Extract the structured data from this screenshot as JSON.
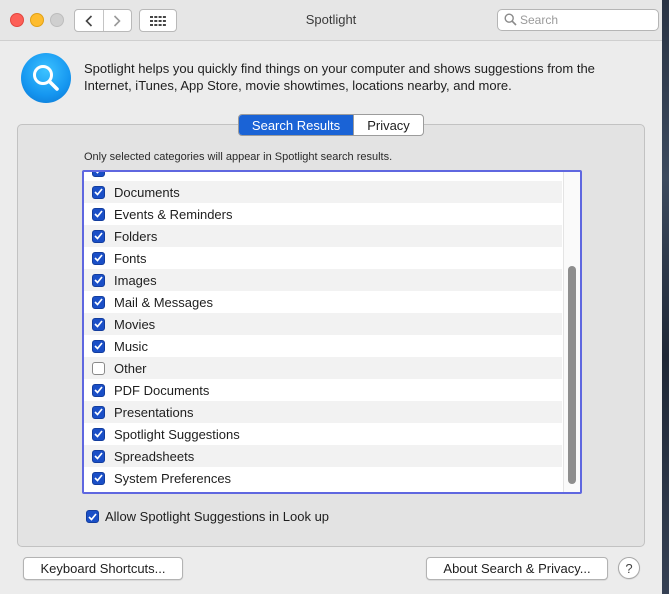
{
  "window": {
    "title": "Spotlight",
    "search_placeholder": "Search"
  },
  "intro_text": "Spotlight helps you quickly find things on your computer and shows suggestions from the Internet, iTunes, App Store, movie showtimes, locations nearby, and more.",
  "tabs": [
    {
      "label": "Search Results",
      "selected": true
    },
    {
      "label": "Privacy",
      "selected": false
    }
  ],
  "note": "Only selected categories will appear in Spotlight search results.",
  "categories": [
    {
      "label": "",
      "checked": true
    },
    {
      "label": "Documents",
      "checked": true
    },
    {
      "label": "Events & Reminders",
      "checked": true
    },
    {
      "label": "Folders",
      "checked": true
    },
    {
      "label": "Fonts",
      "checked": true
    },
    {
      "label": "Images",
      "checked": true
    },
    {
      "label": "Mail & Messages",
      "checked": true
    },
    {
      "label": "Movies",
      "checked": true
    },
    {
      "label": "Music",
      "checked": true
    },
    {
      "label": "Other",
      "checked": false
    },
    {
      "label": "PDF Documents",
      "checked": true
    },
    {
      "label": "Presentations",
      "checked": true
    },
    {
      "label": "Spotlight Suggestions",
      "checked": true
    },
    {
      "label": "Spreadsheets",
      "checked": true
    },
    {
      "label": "System Preferences",
      "checked": true
    }
  ],
  "allow_lookup": {
    "label": "Allow Spotlight Suggestions in Look up",
    "checked": true
  },
  "buttons": {
    "keyboard_shortcuts": "Keyboard Shortcuts...",
    "about": "About Search & Privacy...",
    "help": "?"
  },
  "icons": {
    "back": "chevron-left-icon",
    "forward": "chevron-right-icon",
    "show_all": "grid-icon",
    "search": "search-icon",
    "app": "spotlight-magnifier-icon",
    "check": "checkmark-icon"
  },
  "colors": {
    "accent": "#1a63d6",
    "checkbox": "#1a4fc7",
    "focus_ring": "#5f67e0"
  }
}
